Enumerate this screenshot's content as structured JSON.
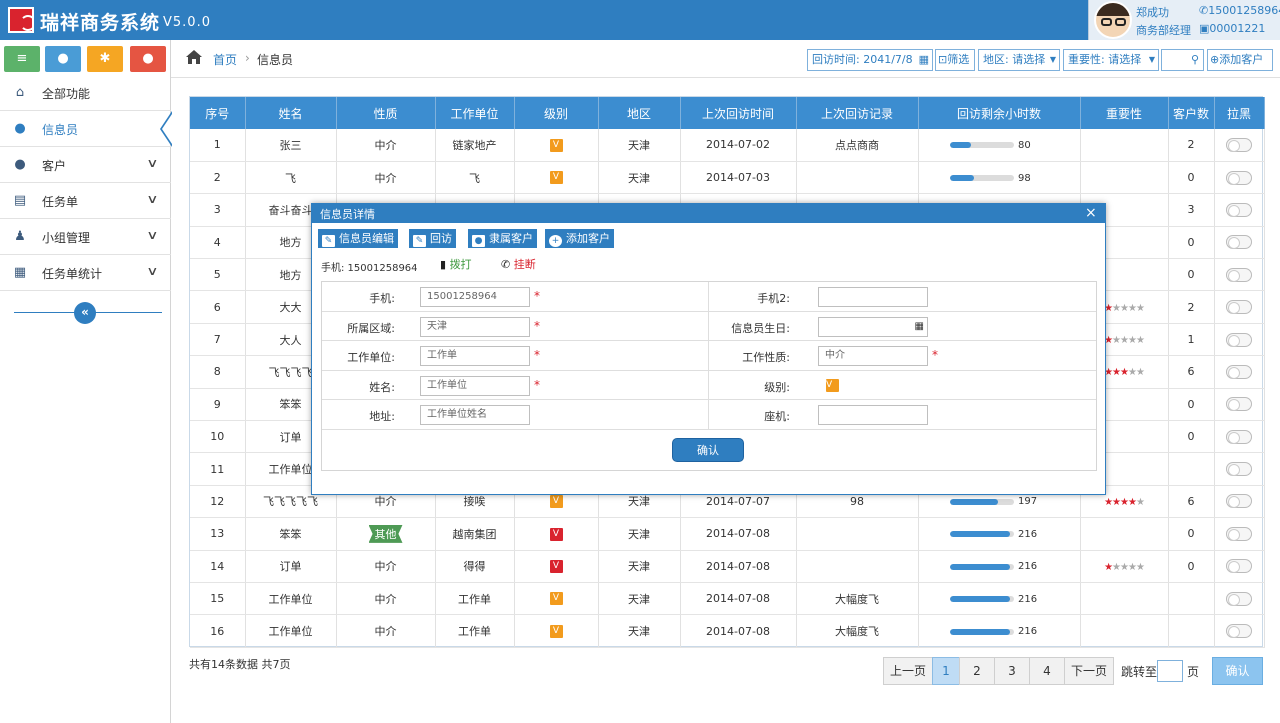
{
  "app": {
    "title": "瑞祥商务系统",
    "version": "V5.0.0"
  },
  "user": {
    "name": "郑成功",
    "phone": "15001258964",
    "role": "商务部经理",
    "code": "00001221"
  },
  "sidebar": {
    "quick": [
      {
        "icon": "list-icon",
        "color": "#5cb26a"
      },
      {
        "icon": "user-icon",
        "color": "#4a9cd6"
      },
      {
        "icon": "gear-icon",
        "color": "#f5a623"
      },
      {
        "icon": "user-remove-icon",
        "color": "#e55542"
      }
    ],
    "items": [
      {
        "label": "全部功能",
        "icon": "home-icon"
      },
      {
        "label": "信息员",
        "icon": "user-icon",
        "active": true
      },
      {
        "label": "客户",
        "icon": "person-icon",
        "chevron": true
      },
      {
        "label": "任务单",
        "icon": "document-icon",
        "chevron": true
      },
      {
        "label": "小组管理",
        "icon": "group-icon",
        "chevron": true
      },
      {
        "label": "任务单统计",
        "icon": "stats-icon",
        "chevron": true
      }
    ]
  },
  "breadcrumb": {
    "home": "首页",
    "current": "信息员"
  },
  "filters": {
    "date_label": "回访时间:",
    "date_value": "2041/7/8",
    "filter_btn": "筛选",
    "region": "地区: 请选择",
    "importance": "重要性: 请选择",
    "add_client": "添加客户"
  },
  "table": {
    "headers": [
      "序号",
      "姓名",
      "性质",
      "工作单位",
      "级别",
      "地区",
      "上次回访时间",
      "上次回访记录",
      "回访剩余小时数",
      "重要性",
      "客户数",
      "拉黑"
    ],
    "rows": [
      {
        "no": "1",
        "name": "张三",
        "nature": "中介",
        "unit": "链家地产",
        "level": "V",
        "level_color": "orange",
        "region": "天津",
        "visit_time": "2014-07-02",
        "record": "点点商商",
        "hours": "80",
        "progress": 0.33,
        "stars": 0,
        "clients": "2"
      },
      {
        "no": "2",
        "name": "飞",
        "nature": "中介",
        "unit": "飞",
        "level": "V",
        "level_color": "orange",
        "region": "天津",
        "visit_time": "2014-07-03",
        "record": "",
        "hours": "98",
        "progress": 0.38,
        "stars": 0,
        "clients": "0"
      },
      {
        "no": "3",
        "name": "奋斗奋斗",
        "nature": "",
        "unit": "",
        "level": "",
        "region": "",
        "visit_time": "",
        "record": "",
        "hours": "",
        "progress": 0,
        "stars": 0,
        "clients": "3"
      },
      {
        "no": "4",
        "name": "地方",
        "nature": "",
        "unit": "",
        "level": "",
        "region": "",
        "visit_time": "",
        "record": "",
        "hours": "",
        "progress": 0,
        "stars": 0,
        "clients": "0"
      },
      {
        "no": "5",
        "name": "地方",
        "nature": "",
        "unit": "",
        "level": "",
        "region": "",
        "visit_time": "",
        "record": "",
        "hours": "",
        "progress": 0,
        "stars": 0,
        "clients": "0"
      },
      {
        "no": "6",
        "name": "大大",
        "nature": "",
        "unit": "",
        "level": "",
        "region": "",
        "visit_time": "",
        "record": "",
        "hours": "",
        "progress": 0,
        "stars": 1,
        "clients": "2"
      },
      {
        "no": "7",
        "name": "大人",
        "nature": "",
        "unit": "",
        "level": "",
        "region": "",
        "visit_time": "",
        "record": "",
        "hours": "",
        "progress": 0,
        "stars": 1,
        "clients": "1"
      },
      {
        "no": "8",
        "name": "飞飞飞飞",
        "nature": "",
        "unit": "",
        "level": "",
        "region": "",
        "visit_time": "",
        "record": "",
        "hours": "",
        "progress": 0,
        "stars": 3,
        "clients": "6"
      },
      {
        "no": "9",
        "name": "笨笨",
        "nature": "",
        "unit": "",
        "level": "",
        "region": "",
        "visit_time": "",
        "record": "",
        "hours": "",
        "progress": 0,
        "stars": 0,
        "clients": "0"
      },
      {
        "no": "10",
        "name": "订单",
        "nature": "",
        "unit": "",
        "level": "",
        "region": "",
        "visit_time": "",
        "record": "",
        "hours": "",
        "progress": 0,
        "stars": 0,
        "clients": "0"
      },
      {
        "no": "11",
        "name": "工作单位",
        "nature": "",
        "unit": "",
        "level": "",
        "region": "",
        "visit_time": "",
        "record": "",
        "hours": "",
        "progress": 0,
        "stars": 0,
        "clients": ""
      },
      {
        "no": "12",
        "name": "飞飞飞飞飞",
        "nature": "中介",
        "unit": "接唉",
        "level": "V",
        "level_color": "orange",
        "region": "天津",
        "visit_time": "2014-07-07",
        "record": "98",
        "hours": "197",
        "progress": 0.75,
        "stars": 4,
        "clients": "6"
      },
      {
        "no": "13",
        "name": "笨笨",
        "nature": "其他",
        "nature_tag": true,
        "unit": "越南集团",
        "level": "V",
        "level_color": "red",
        "region": "天津",
        "visit_time": "2014-07-08",
        "record": "",
        "hours": "216",
        "progress": 0.93,
        "stars": 0,
        "clients": "0"
      },
      {
        "no": "14",
        "name": "订单",
        "nature": "中介",
        "unit": "得得",
        "level": "V",
        "level_color": "red",
        "region": "天津",
        "visit_time": "2014-07-08",
        "record": "",
        "hours": "216",
        "progress": 0.93,
        "stars": 1,
        "clients": "0"
      },
      {
        "no": "15",
        "name": "工作单位",
        "nature": "中介",
        "unit": "工作单",
        "level": "V",
        "level_color": "orange",
        "region": "天津",
        "visit_time": "2014-07-08",
        "record": "大幅度飞",
        "hours": "216",
        "progress": 0.93,
        "stars": 0,
        "clients": ""
      },
      {
        "no": "16",
        "name": "工作单位",
        "nature": "中介",
        "unit": "工作单",
        "level": "V",
        "level_color": "orange",
        "region": "天津",
        "visit_time": "2014-07-08",
        "record": "大幅度飞",
        "hours": "216",
        "progress": 0.93,
        "stars": 0,
        "clients": ""
      }
    ]
  },
  "summary": "共有14条数据   共7页",
  "pagination": {
    "prev": "上一页",
    "pages": [
      "1",
      "2",
      "3",
      "4"
    ],
    "current": "1",
    "next": "下一页",
    "jump_label": "跳转至",
    "jump_unit": "页",
    "confirm": "确认"
  },
  "modal": {
    "title": "信息员详情",
    "close": "×",
    "buttons": [
      {
        "label": "信息员编辑",
        "icon": "edit-icon"
      },
      {
        "label": "回访",
        "icon": "revisit-icon"
      },
      {
        "label": "隶属客户",
        "icon": "person-icon"
      },
      {
        "label": "添加客户",
        "icon": "plus-circle-icon"
      }
    ],
    "phone_line": "手机: 15001258964",
    "dial": "拨打",
    "hangup": "挂断",
    "fields": {
      "mobile": {
        "label": "手机:",
        "value": "15001258964"
      },
      "mobile2": {
        "label": "手机2:",
        "value": ""
      },
      "area": {
        "label": "所属区域:",
        "value": "天津"
      },
      "birthday": {
        "label": "信息员生日:",
        "value": ""
      },
      "unit": {
        "label": "工作单位:",
        "value": "工作单"
      },
      "nature": {
        "label": "工作性质:",
        "value": "中介"
      },
      "name": {
        "label": "姓名:",
        "value": "工作单位"
      },
      "level": {
        "label": "级别:",
        "value": "V"
      },
      "address": {
        "label": "地址:",
        "value": "工作单位姓名"
      },
      "landline": {
        "label": "座机:",
        "value": ""
      }
    },
    "confirm": "确认"
  },
  "colors": {
    "primary": "#2f7ec0",
    "header": "#3c8dd0",
    "danger": "#d9232e",
    "orange": "#f29b1d",
    "green": "#4e9a55"
  }
}
